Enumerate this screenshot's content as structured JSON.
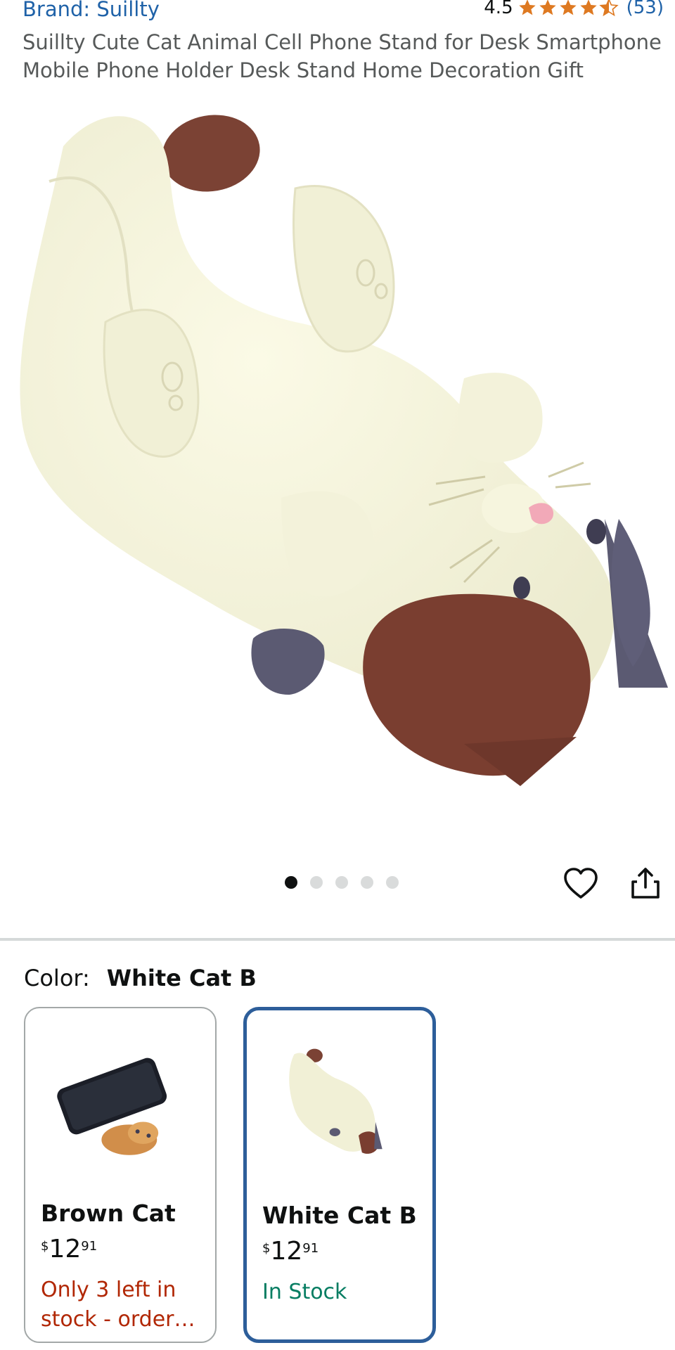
{
  "header": {
    "brand": "Brand: Suillty",
    "rating_value": "4.5",
    "rating_stars": 4.5,
    "rating_count": "(53)",
    "title": "Suillty Cute Cat Animal Cell Phone Stand for Desk Smartphone Mobile Phone Holder Desk Stand Home Decoration Gift"
  },
  "gallery": {
    "image_count": 5,
    "active_index": 0,
    "icons": [
      "heart-icon",
      "share-icon"
    ]
  },
  "variation": {
    "label": "Color:",
    "selected": "White Cat B",
    "options": [
      {
        "name": "Brown Cat",
        "price_symbol": "$",
        "price_whole": "12",
        "price_fraction": "91",
        "status": "Only 3 left in stock - order…",
        "status_color": "#b12704",
        "selected": false
      },
      {
        "name": "White Cat B",
        "price_symbol": "$",
        "price_whole": "12",
        "price_fraction": "91",
        "status": "In Stock",
        "status_color": "#067d62",
        "selected": true
      }
    ]
  },
  "colors": {
    "link": "#1f62a8",
    "star": "#de7921",
    "selected_border": "#2d5e9a"
  }
}
